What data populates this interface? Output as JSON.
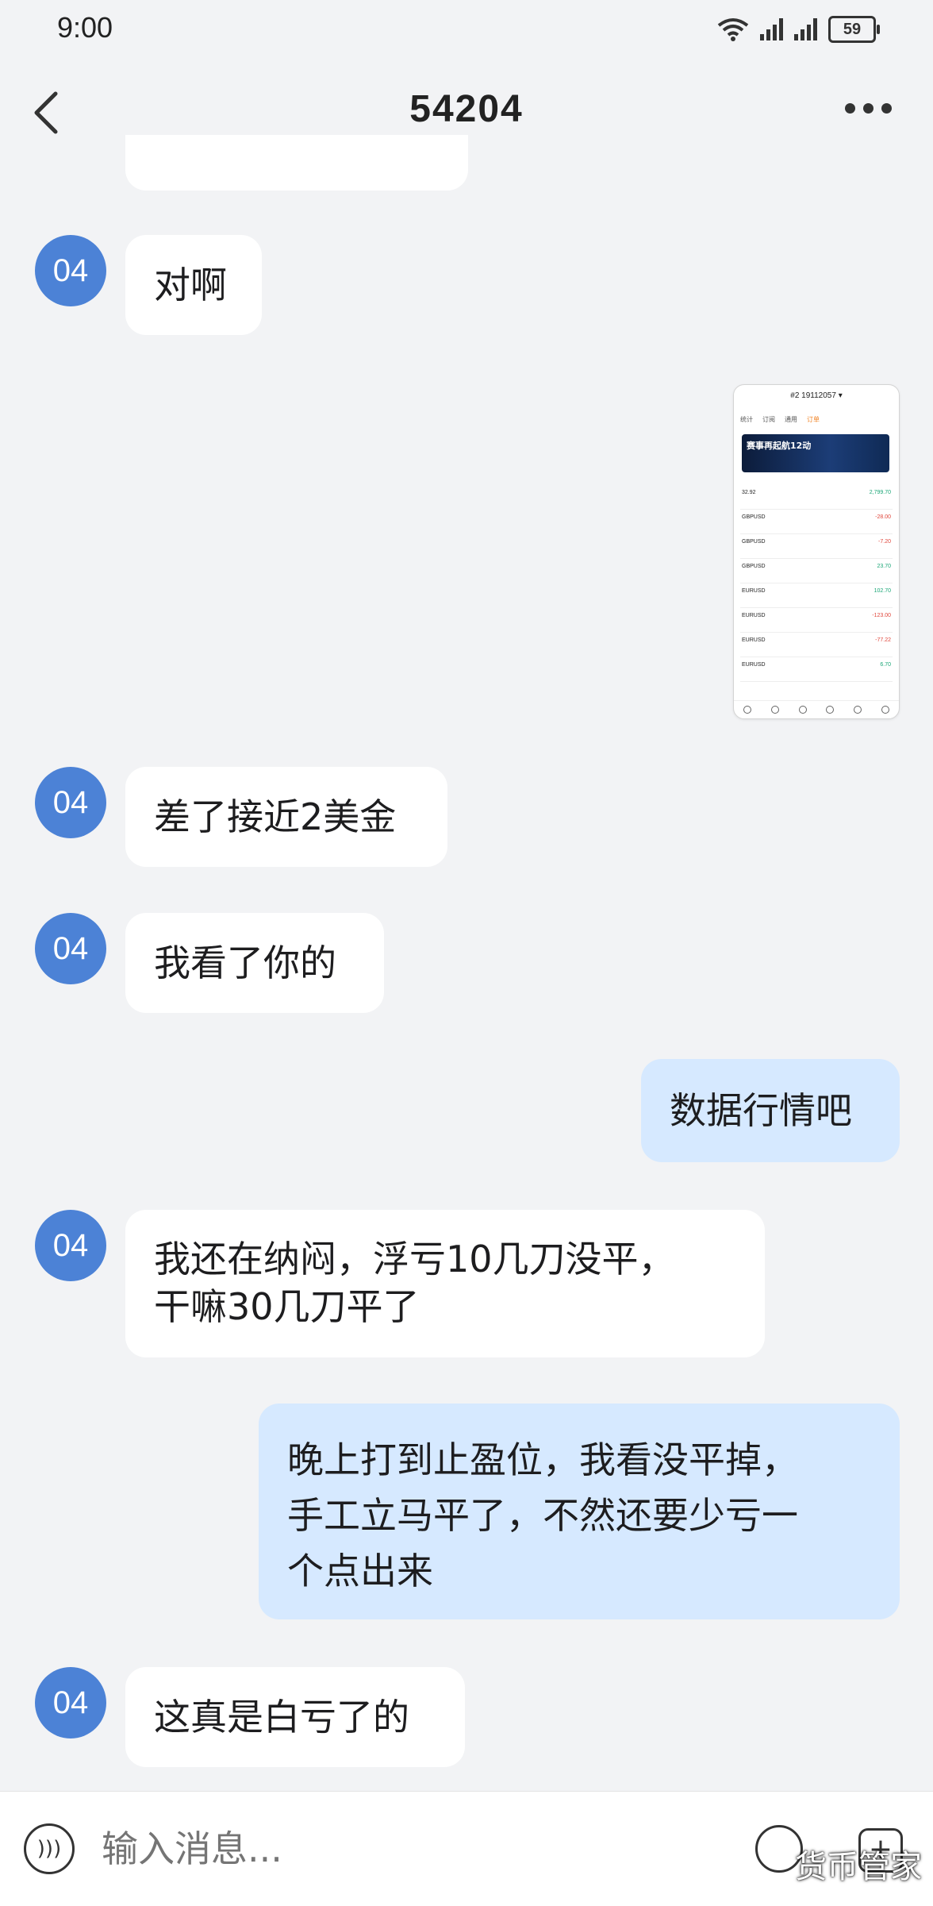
{
  "status_bar": {
    "time": "9:00",
    "battery": "59",
    "network1": "4G",
    "network2": "4G"
  },
  "header": {
    "title": "54204"
  },
  "messages": [
    {
      "side": "left",
      "avatar": "04",
      "text": "对啊"
    },
    {
      "side": "right",
      "type": "image"
    },
    {
      "side": "left",
      "avatar": "04",
      "text": "差了接近2美金"
    },
    {
      "side": "left",
      "avatar": "04",
      "text": "我看了你的"
    },
    {
      "side": "right",
      "text": "数据行情吧"
    },
    {
      "side": "left",
      "avatar": "04",
      "lines": [
        "我还在纳闷，浮亏10几刀没平，",
        "干嘛30几刀平了"
      ]
    },
    {
      "side": "right",
      "lines": [
        "晚上打到止盈位，我看没平掉，",
        "手工立马平了，不然还要少亏一",
        "个点出来"
      ]
    },
    {
      "side": "left",
      "avatar": "04",
      "text": "这真是白亏了的"
    }
  ],
  "thumbnail": {
    "account": "#2  19112057 ▾",
    "tabs": [
      "统计",
      "订阅",
      "通用",
      "订单"
    ],
    "banner": "赛事再起航12动",
    "rows": [
      {
        "symbol": "32.92",
        "value": "2,799.70",
        "dir": "pos"
      },
      {
        "symbol": "GBPUSD",
        "value": "-28.00",
        "dir": "neg"
      },
      {
        "symbol": "GBPUSD",
        "value": "-7.20",
        "dir": "neg"
      },
      {
        "symbol": "GBPUSD",
        "value": "23.70",
        "dir": "pos"
      },
      {
        "symbol": "EURUSD",
        "value": "102.70",
        "dir": "pos"
      },
      {
        "symbol": "EURUSD",
        "value": "-123.00",
        "dir": "neg"
      },
      {
        "symbol": "EURUSD",
        "value": "-77.22",
        "dir": "neg"
      },
      {
        "symbol": "EURUSD",
        "value": "6.70",
        "dir": "pos"
      }
    ]
  },
  "input": {
    "placeholder": "输入消息..."
  },
  "watermark": "货币管家",
  "colors": {
    "avatar": "#4c82d6",
    "my_bubble": "#d6e9ff",
    "other_bubble": "#ffffff",
    "background": "#f2f3f5"
  }
}
